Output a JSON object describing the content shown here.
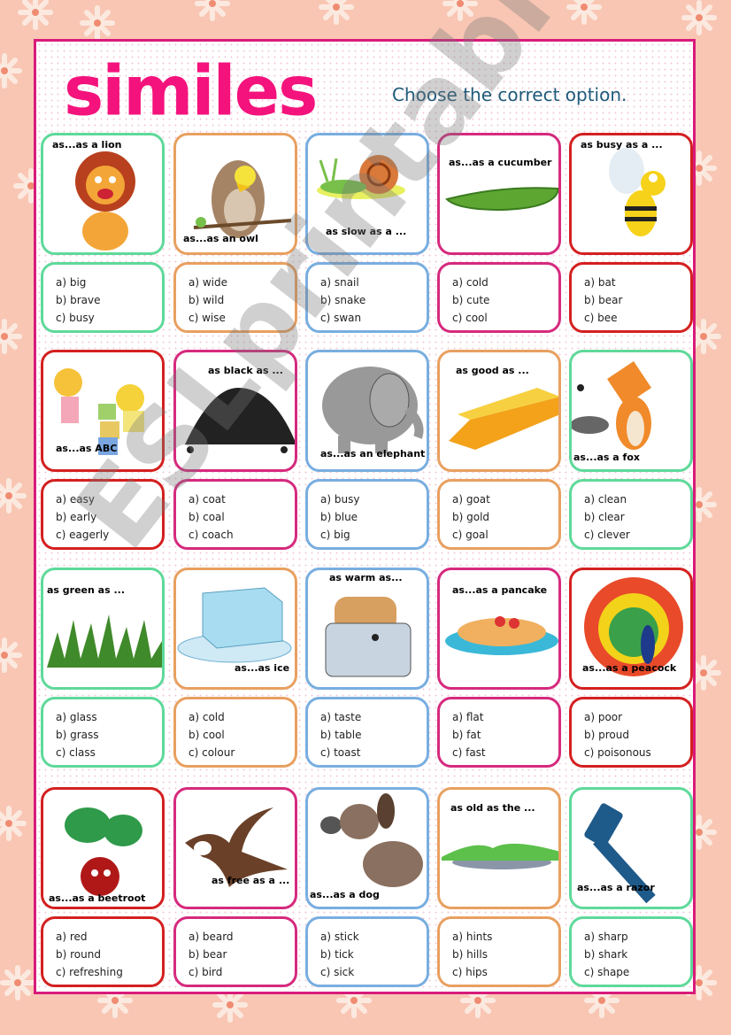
{
  "worksheet": {
    "title": "similes",
    "instruction": "Choose the correct option.",
    "watermark": "ESLprintables.com",
    "colors": {
      "background": "#f9c6b4",
      "frame": "#d81b7a",
      "title": "#f4127c",
      "instruction": "#1e5a7a",
      "green": "#5fd99a",
      "orange": "#e8a060",
      "blue": "#79aee0",
      "magenta": "#d62a7e",
      "red": "#d42020"
    }
  },
  "items": [
    {
      "caption": "as...as a lion",
      "picture": "lion",
      "options": [
        "a) big",
        "b) brave",
        "c) busy"
      ]
    },
    {
      "caption": "as...as an owl",
      "picture": "owl",
      "options": [
        "a) wide",
        "b) wild",
        "c) wise"
      ]
    },
    {
      "caption": "as slow as a ...",
      "picture": "snail",
      "options": [
        "a) snail",
        "b) snake",
        "c) swan"
      ]
    },
    {
      "caption": "as...as a cucumber",
      "picture": "cucumber",
      "options": [
        "a) cold",
        "b) cute",
        "c) cool"
      ]
    },
    {
      "caption": "as busy as a ...",
      "picture": "bee",
      "options": [
        "a) bat",
        "b) bear",
        "c) bee"
      ]
    },
    {
      "caption": "as...as ABC",
      "picture": "children-with-blocks",
      "options": [
        "a) easy",
        "b) early",
        "c) eagerly"
      ]
    },
    {
      "caption": "as black as ...",
      "picture": "coal",
      "options": [
        "a) coat",
        "b) coal",
        "c) coach"
      ]
    },
    {
      "caption": "as...as an elephant",
      "picture": "elephant",
      "options": [
        "a) busy",
        "b) blue",
        "c) big"
      ]
    },
    {
      "caption": "as good as ...",
      "picture": "gold-bar",
      "options": [
        "a) goat",
        "b) gold",
        "c) goal"
      ]
    },
    {
      "caption": "as...as a fox",
      "picture": "fox",
      "options": [
        "a) clean",
        "b) clear",
        "c) clever"
      ]
    },
    {
      "caption": "as green as ...",
      "picture": "grass",
      "options": [
        "a) glass",
        "b) grass",
        "c) class"
      ]
    },
    {
      "caption": "as...as ice",
      "picture": "ice-cube",
      "options": [
        "a) cold",
        "b) cool",
        "c) colour"
      ]
    },
    {
      "caption": "as warm as...",
      "picture": "toaster",
      "options": [
        "a) taste",
        "b) table",
        "c) toast"
      ]
    },
    {
      "caption": "as...as a pancake",
      "picture": "pancake",
      "options": [
        "a) flat",
        "b) fat",
        "c) fast"
      ]
    },
    {
      "caption": "as...as a peacock",
      "picture": "peacock",
      "options": [
        "a) poor",
        "b) proud",
        "c) poisonous"
      ]
    },
    {
      "caption": "as...as a beetroot",
      "picture": "beetroot",
      "options": [
        "a) red",
        "b) round",
        "c) refreshing"
      ]
    },
    {
      "caption": "as free as a ...",
      "picture": "swallow",
      "options": [
        "a) beard",
        "b) bear",
        "c) bird"
      ]
    },
    {
      "caption": "as...as a dog",
      "picture": "dog",
      "options": [
        "a) stick",
        "b) tick",
        "c) sick"
      ]
    },
    {
      "caption": "as old as the ...",
      "picture": "hills",
      "options": [
        "a) hints",
        "b) hills",
        "c) hips"
      ]
    },
    {
      "caption": "as...as a razor",
      "picture": "razor",
      "options": [
        "a) sharp",
        "b) shark",
        "c) shape"
      ]
    }
  ]
}
